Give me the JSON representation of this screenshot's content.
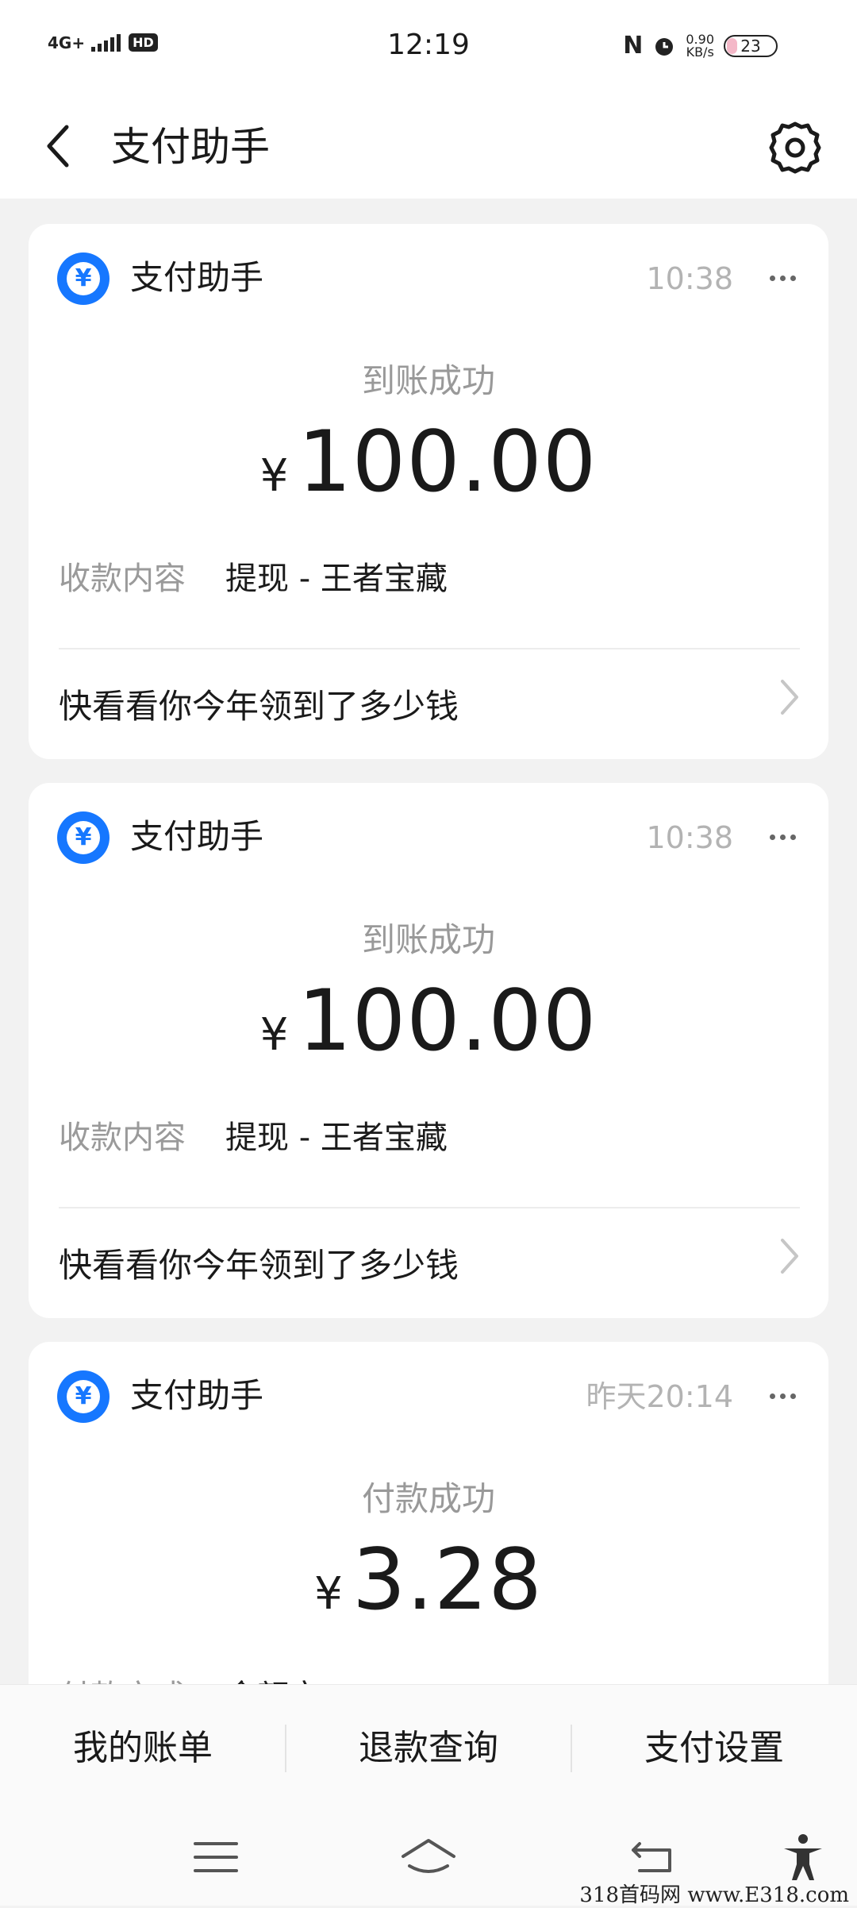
{
  "status_bar": {
    "network": "4G+",
    "hd_badge": "HD",
    "time": "12:19",
    "nfc": "N",
    "speed_value": "0.90",
    "speed_unit": "KB/s",
    "battery": "23",
    "icons": [
      "signal-icon",
      "nfc-icon",
      "alarm-icon",
      "battery-icon"
    ]
  },
  "header": {
    "title": "支付助手",
    "back_icon": "chevron-left-icon",
    "settings_icon": "gear-icon"
  },
  "cards": [
    {
      "sender": "支付助手",
      "time": "10:38",
      "status": "到账成功",
      "currency": "¥",
      "amount": "100.00",
      "detail_label": "收款内容",
      "detail_value": "提现 - 王者宝藏",
      "link": "快看看你今年领到了多少钱"
    },
    {
      "sender": "支付助手",
      "time": "10:38",
      "status": "到账成功",
      "currency": "¥",
      "amount": "100.00",
      "detail_label": "收款内容",
      "detail_value": "提现 - 王者宝藏",
      "link": "快看看你今年领到了多少钱"
    },
    {
      "sender": "支付助手",
      "time": "昨天20:14",
      "status": "付款成功",
      "currency": "¥",
      "amount": "3.28",
      "detail_label": "付款方式",
      "detail_value": "余额宝"
    }
  ],
  "bottom_menu": [
    "我的账单",
    "退款查询",
    "支付设置"
  ],
  "nav": [
    "menu-icon",
    "home-icon",
    "back-icon",
    "accessibility-icon"
  ],
  "watermark": "318首码网 www.E318.com",
  "colors": {
    "accent": "#1677ff",
    "background": "#f2f2f2",
    "muted": "#9a9a9a"
  }
}
